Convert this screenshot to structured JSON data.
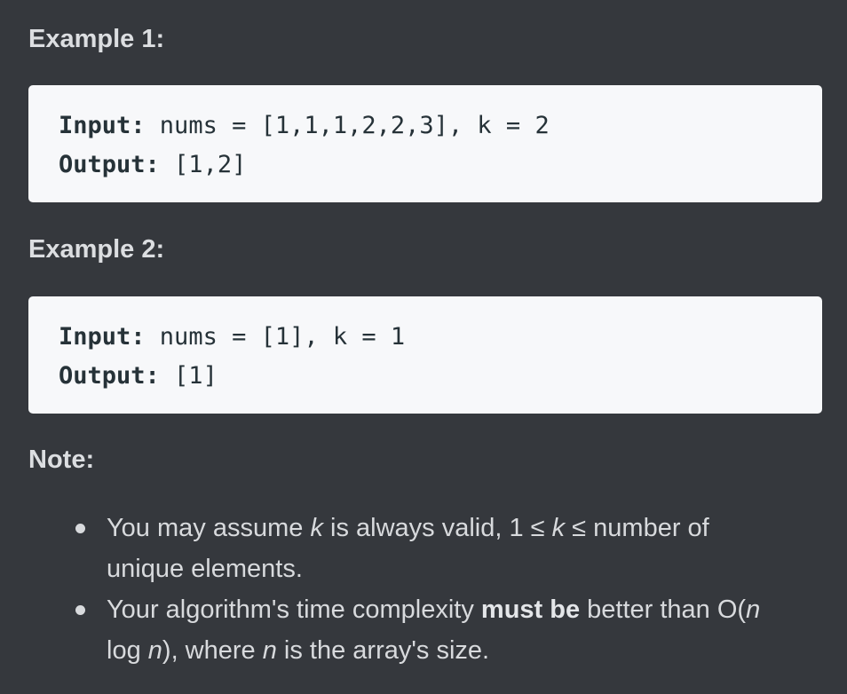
{
  "examples": [
    {
      "title": "Example 1:",
      "input_label": "Input:",
      "input_value": " nums = [1,1,1,2,2,3], k = 2",
      "output_label": "Output:",
      "output_value": " [1,2]"
    },
    {
      "title": "Example 2:",
      "input_label": "Input:",
      "input_value": " nums = [1], k = 1",
      "output_label": "Output:",
      "output_value": " [1]"
    }
  ],
  "note": {
    "title": "Note:",
    "item1": {
      "part1": "You may assume ",
      "var1": "k",
      "part2": " is always valid, 1 ≤ ",
      "var2": "k",
      "part3": " ≤ number of unique elements."
    },
    "item2": {
      "part1": "Your algorithm's time complexity ",
      "strong": "must be",
      "part2": " better than O(",
      "var1": "n",
      "part3": " log ",
      "var2": "n",
      "part4": "), where ",
      "var3": "n",
      "part5": " is the array's size."
    }
  }
}
